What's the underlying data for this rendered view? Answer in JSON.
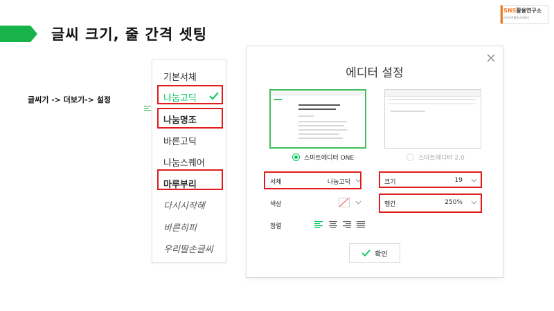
{
  "slide": {
    "title": "글씨 크기, 줄 간격 셋팅",
    "instruction": "글씨기 -> 더보기-> 설정",
    "accent_color": "#17b34a"
  },
  "logo": {
    "main_prefix": "SNS",
    "main_suffix": "활용연구소",
    "subtitle": "스마트폰활용교육센터"
  },
  "font_menu": {
    "items": [
      {
        "label": "기본서체"
      },
      {
        "label": "나눔고딕"
      },
      {
        "label": "나눔명조"
      },
      {
        "label": "바른고딕"
      },
      {
        "label": "나눔스퀘어"
      },
      {
        "label": "마루부리"
      },
      {
        "label": "다시시작해"
      },
      {
        "label": "바른히피"
      },
      {
        "label": "우리딸손글씨"
      }
    ],
    "selected": "나눔고딕",
    "selected_color": "#03c75a"
  },
  "modal": {
    "title": "에디터 설정",
    "editor_one": {
      "label": "스마트에디터 ONE",
      "checked": true
    },
    "editor_two": {
      "label": "스마트에디터 2.0",
      "checked": false
    },
    "font": {
      "label": "서체",
      "value": "나눔고딕"
    },
    "size": {
      "label": "크기",
      "value": "19"
    },
    "color": {
      "label": "색상"
    },
    "line_height": {
      "label": "행간",
      "value": "250%"
    },
    "alignment": {
      "label": "정렬",
      "options": [
        "left",
        "center",
        "right",
        "justify"
      ],
      "selected": "left"
    },
    "confirm_label": "확인",
    "highlight_color": "#e01b1b"
  }
}
